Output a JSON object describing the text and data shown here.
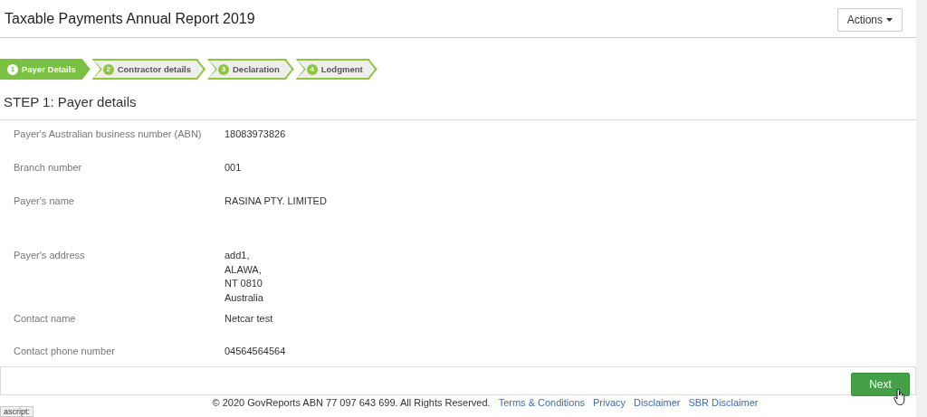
{
  "header": {
    "title": "Taxable Payments Annual Report 2019",
    "actions_button": "Actions"
  },
  "steps": [
    {
      "number": "1",
      "label": "Payer Details",
      "selected": true
    },
    {
      "number": "2",
      "label": "Contractor details",
      "selected": false
    },
    {
      "number": "3",
      "label": "Declaration",
      "selected": false
    },
    {
      "number": "4",
      "label": "Lodgment",
      "selected": false
    }
  ],
  "step_heading": "STEP 1: Payer details",
  "fields": [
    {
      "label": "Payer's Australian business number (ABN)",
      "value": [
        "18083973826"
      ]
    },
    {
      "label": "Branch number",
      "value": [
        "001"
      ]
    },
    {
      "label": "Payer's name",
      "value": [
        "RASINA PTY. LIMITED"
      ]
    },
    {
      "label": "Payer's address",
      "value": [
        "add1,",
        "ALAWA,",
        "NT 0810",
        "Australia"
      ]
    },
    {
      "label": "Contact name",
      "value": [
        "Netcar test"
      ]
    },
    {
      "label": "Contact phone number",
      "value": [
        "04564564564"
      ]
    }
  ],
  "next_button": "Next",
  "status_text": "ascript:",
  "footer": {
    "copyright": "© 2020 GovReports ABN 77 097 643 699. All Rights Reserved.",
    "links": [
      "Terms & Conditions",
      "Privacy",
      "Disclaimer",
      "SBR Disclaimer"
    ]
  }
}
